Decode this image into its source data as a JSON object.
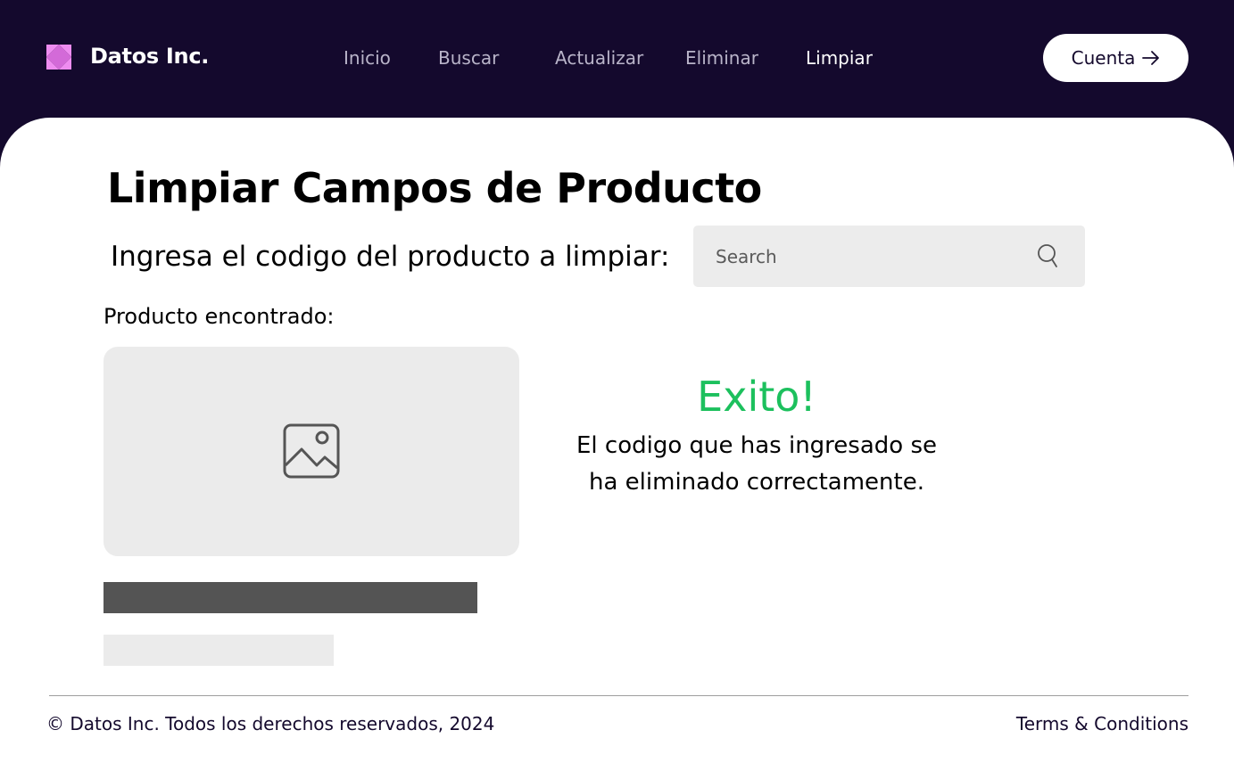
{
  "header": {
    "brand": "Datos Inc.",
    "nav": [
      {
        "label": "Inicio"
      },
      {
        "label": "Buscar"
      },
      {
        "label": "Actualizar"
      },
      {
        "label": "Eliminar"
      },
      {
        "label": "Limpiar",
        "active": true
      }
    ],
    "account_label": "Cuenta"
  },
  "main": {
    "title": "Limpiar Campos de Producto",
    "prompt": "Ingresa el codigo del producto a limpiar:",
    "search": {
      "placeholder": "Search",
      "value": ""
    },
    "found_label": "Producto encontrado:",
    "success_title": "Exito!",
    "success_message": "El codigo que has ingresado se ha eliminado correctamente."
  },
  "footer": {
    "copyright": "© Datos Inc. Todos los derechos reservados, 2024",
    "terms": "Terms & Conditions"
  },
  "colors": {
    "header_bg": "#14092d",
    "logo_accent": "#ee8cf0",
    "success": "#1cc05d",
    "placeholder_bg": "#ebebeb",
    "bar_dark": "#545454"
  },
  "icons": [
    "logo-icon",
    "arrow-right-icon",
    "search-icon",
    "image-icon"
  ]
}
